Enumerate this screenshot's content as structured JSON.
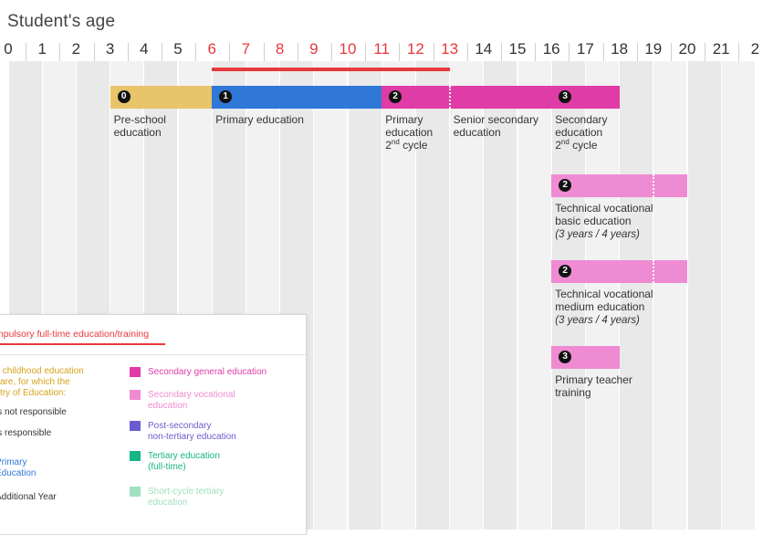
{
  "chart_data": {
    "type": "timeline",
    "title": "Student's age",
    "axis_ticks": [
      "0",
      "1",
      "2",
      "3",
      "4",
      "5",
      "6",
      "7",
      "8",
      "9",
      "10",
      "11",
      "12",
      "13",
      "14",
      "15",
      "16",
      "17",
      "18",
      "19",
      "20",
      "21",
      "2"
    ],
    "compulsory_range": [
      6,
      13
    ],
    "compulsory_color": "#e8383d",
    "bars": [
      {
        "level": "0",
        "start": 3,
        "end": 6,
        "row": 0,
        "color": "#e8c46a",
        "label": "Pre-school\neducation",
        "label_at": 3
      },
      {
        "level": "1",
        "start": 6,
        "end": 11,
        "row": 0,
        "color": "#2f78d8",
        "label": "Primary education",
        "label_at": 6
      },
      {
        "level": "2",
        "start": 11,
        "end": 16,
        "row": 0,
        "color": "#e03ca7",
        "dividers": [
          13
        ],
        "label": "Primary\neducation\n2nd cycle",
        "label_at": 11
      },
      {
        "level": "3",
        "start": 16,
        "end": 18,
        "row": 0,
        "color": "#e03ca7",
        "label": "Secondary\neducation\n2nd cycle",
        "label_at": 16
      },
      {
        "level": "2",
        "start": 16,
        "end": 20,
        "row": 1,
        "color": "#ef8bd2",
        "dividers": [
          19
        ],
        "label": "Technical vocational\nbasic education",
        "note": "(3 years / 4 years)",
        "label_at": 16
      },
      {
        "level": "2",
        "start": 16,
        "end": 20,
        "row": 2,
        "color": "#ef8bd2",
        "dividers": [
          19
        ],
        "label": "Technical vocational\nmedium education",
        "note": "(3 years / 4 years)",
        "label_at": 16
      },
      {
        "level": "3",
        "start": 16,
        "end": 18,
        "row": 3,
        "color": "#ef8bd2",
        "label": "Primary teacher\ntraining",
        "label_at": 16
      }
    ],
    "extra_labels": [
      {
        "text": "Senior secondary\neducation",
        "at": 13
      }
    ]
  },
  "legend": {
    "heading": "mpulsory full-time education/training",
    "items_left": [
      {
        "text": "y childhood education\ncare, for which the\nstry of Education:",
        "color": "#d8a21b"
      },
      {
        "text": "is not responsible",
        "color": "#333333"
      },
      {
        "text": "is responsible",
        "color": "#333333"
      },
      {
        "text": "Primary\nEducation",
        "color": "#2f78d8"
      },
      {
        "text": "Additional Year",
        "color": "#333333"
      }
    ],
    "items_right": [
      {
        "text": "Secondary general education",
        "swatch": "#e03ca7",
        "color": "#e03ca7"
      },
      {
        "text": "Secondary vocational\neducation",
        "swatch": "#ef8bd2",
        "color": "#ef8bd2"
      },
      {
        "text": "Post-secondary\nnon-tertiary education",
        "swatch": "#6a5ccf",
        "color": "#6a5ccf"
      },
      {
        "text": "Tertiary education\n(full-time)",
        "swatch": "#16b585",
        "color": "#16b585"
      },
      {
        "text": "Short-cycle tertiary\neducation",
        "swatch": "#9fe0bf",
        "color": "#9fe0bf"
      }
    ]
  }
}
